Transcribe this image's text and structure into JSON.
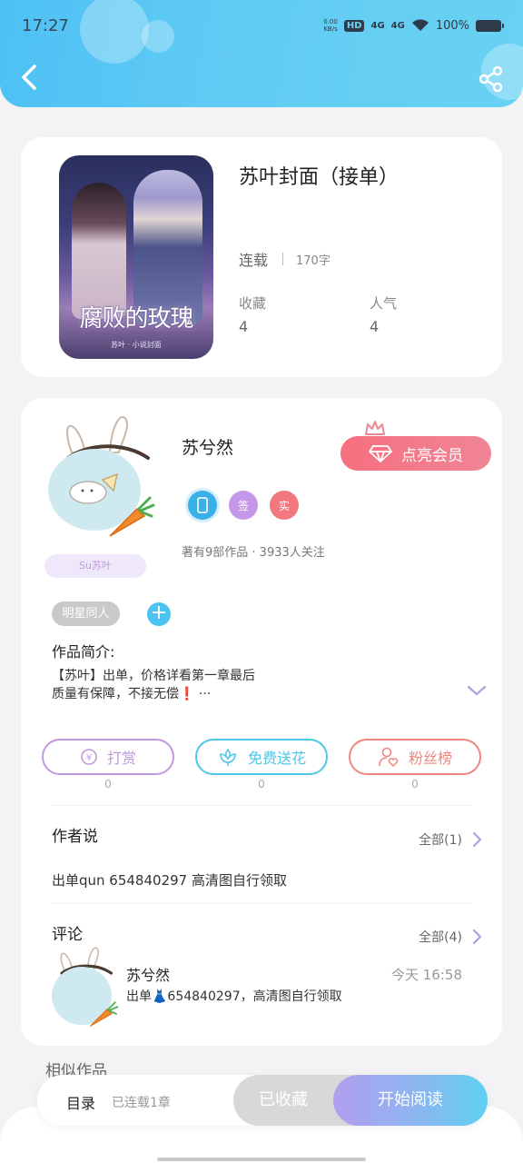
{
  "status": {
    "time": "17:27",
    "network_speed_top": "0.00",
    "network_speed_bottom": "KB/s",
    "hd": "HD",
    "sig1": "4G",
    "sig2": "4G",
    "battery": "100%"
  },
  "book": {
    "title": "苏叶封面（接单）",
    "status": "连载",
    "word_count": "170字",
    "favorites_label": "收藏",
    "favorites": "4",
    "popularity_label": "人气",
    "popularity": "4",
    "cover_title": "腐败的玫瑰",
    "cover_subtitle": "苏叶 · 小说封面"
  },
  "author": {
    "name": "苏兮然",
    "vip_button": "点亮会员",
    "tag_name": "Su苏叶",
    "badges": [
      {
        "label": "",
        "color": "#3ab0e8"
      },
      {
        "label": "签",
        "color": "#c597e8"
      },
      {
        "label": "实",
        "color": "#f2787f"
      }
    ],
    "works": "著有9部作品 · 3933人关注"
  },
  "genre": "明星同人",
  "intro": {
    "heading": "作品简介:",
    "text": "【苏叶】出单，价格详看第一章最后\n质量有保障，不接无偿❗ ···"
  },
  "actions": [
    {
      "label": "打赏",
      "count": "0",
      "color": "#c198e0"
    },
    {
      "label": "免费送花",
      "count": "0",
      "color": "#4fc6e8"
    },
    {
      "label": "粉丝榜",
      "count": "0",
      "color": "#f0857f"
    }
  ],
  "author_said": {
    "heading": "作者说",
    "all": "全部(1)",
    "text": "出单qun 654840297 高清图自行领取"
  },
  "comments": {
    "heading": "评论",
    "all": "全部(4)",
    "user": "苏兮然",
    "time": "今天 16:58",
    "text": "出单👗654840297，高清图自行领取"
  },
  "similar": "相似作品",
  "bottom": {
    "toc": "目录",
    "toc_sub": "已连载1章",
    "fav": "已收藏",
    "read": "开始阅读"
  }
}
